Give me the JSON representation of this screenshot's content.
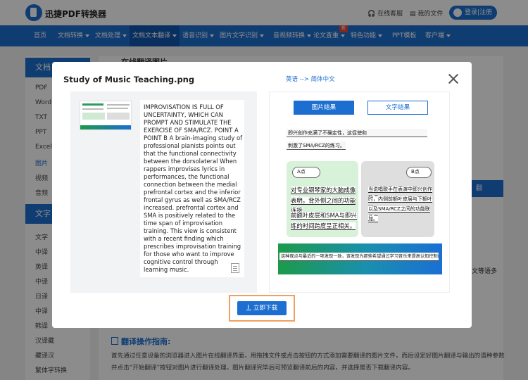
{
  "header": {
    "brand": "迅捷PDF转换器",
    "service": "在线客服",
    "my_files": "我的文件",
    "login": "登录|注册"
  },
  "nav": {
    "items": [
      "首页",
      "文档转换",
      "文档处理",
      "文档文本翻译",
      "语音识别",
      "图片文字识别",
      "音视频转换",
      "论文查重",
      "特色功能",
      "PPT模板",
      "客户端"
    ],
    "badge": "新"
  },
  "sidebar": {
    "heading1": "文档",
    "items1": [
      "PDF",
      "Word",
      "TXT",
      "PPT",
      "Excel",
      "图片",
      "视频",
      "音频"
    ],
    "heading2": "文字",
    "items2": [
      "文字",
      "中译",
      "英译",
      "中译",
      "日译",
      "中译",
      "韩译",
      "汉译藏",
      "藏译汉",
      "繁体字转换"
    ]
  },
  "main": {
    "section_title": "在线翻译图片",
    "side_button": "翻",
    "side_text": "文等语多"
  },
  "guide": {
    "title": "翻译操作指南:",
    "text": "首先通过任意设备的浏览器进入图片在线翻译界面，用拖拽文件或点击按钮的方式添加需要翻译的图片文件，而后设定好图片翻译与输出的语种参数并点击“开始翻译”按钮对图片进行翻译处理。图片翻译完毕后可预览翻译前后的内容，并选择是否下载翻译内容。"
  },
  "modal": {
    "title": "Study of Music Teaching.png",
    "lang_pair": "英语 --> 简体中文",
    "ocr_text": "IMPROVISATION IS FULL OF UNCERTAINTY, WHICH CAN PROMPT AND STIMULATE THE EXERCISE OF SMA/RCZ. POINT A POINT B A brain-imaging study of professional pianists points out that the functional connectivity between the dorsolateral When rappers improvises lyrics in performances, the functional connection between the medial prefrontal cortex and the inferior frontal gyrus as well as SMA/RCZ increased. prefrontal cortex and SMA is positively related to the time span of improvisation training. This view is consistent with a recent finding which prescribes improvisation training for those who want to improve cognitive control through learning music.",
    "tab_image": "图片结果",
    "tab_text": "文字结果",
    "download": "立即下载",
    "preview": {
      "line1": "即兴创作充满了不确定性，这促使和",
      "line2": "刺激了SMA/RCZ的练习。",
      "label_a": "A点",
      "label_b": "B点",
      "green_lines": [
        "对专业钢琴家的大脑成像研究",
        "表明，背外侧之间的功能连接",
        "前额叶皮层和SMA与即兴训",
        "练的时间跨度呈正相关。"
      ],
      "gray_lines": [
        "当说唱歌手在表演中即兴创作歌词",
        "时，内侧前额叶皮层与下额叶回",
        "以及SMA/RCZ之间的功能联系增",
        "加。"
      ],
      "bottom": "这种观点与最近的一项发现一致，该发现为那些希望通过学习音乐来提高认知控制的人规定了即兴训练。"
    }
  }
}
